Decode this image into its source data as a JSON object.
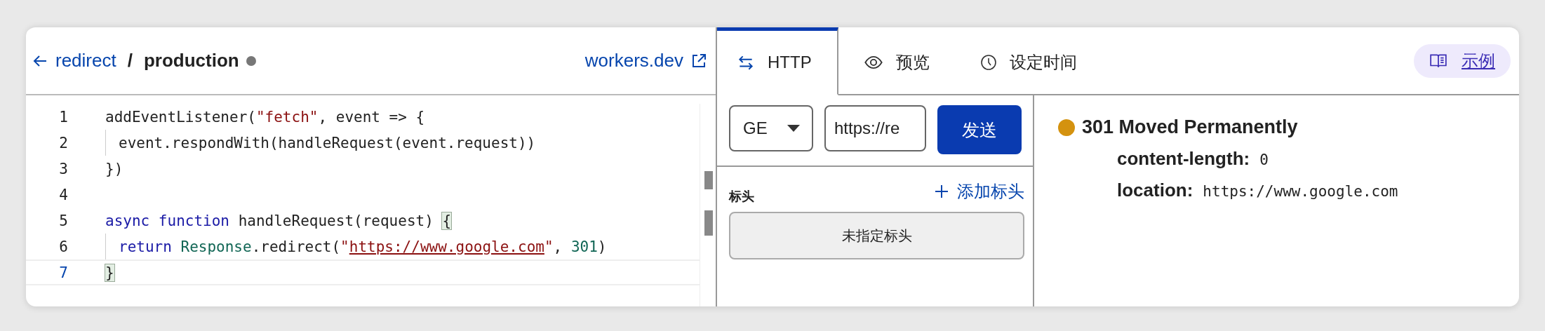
{
  "header": {
    "back_label": "redirect",
    "separator": "/",
    "environment": "production",
    "link": "workers.dev"
  },
  "editor": {
    "lines": [
      {
        "number": "1",
        "active": false,
        "indented": false,
        "tokens": [
          {
            "text": "addEventListener(",
            "kind": "plain"
          },
          {
            "text": "\"fetch\"",
            "kind": "string"
          },
          {
            "text": ", event => {",
            "kind": "plain"
          }
        ]
      },
      {
        "number": "2",
        "active": false,
        "indented": true,
        "tokens": [
          {
            "text": "event.respondWith(handleRequest(event.request))",
            "kind": "plain"
          }
        ]
      },
      {
        "number": "3",
        "active": false,
        "indented": false,
        "tokens": [
          {
            "text": "})",
            "kind": "plain"
          }
        ]
      },
      {
        "number": "4",
        "active": false
      },
      {
        "number": "5",
        "active": false,
        "indented": false,
        "tokens": [
          {
            "text": "async function",
            "kind": "keyword"
          },
          {
            "text": " handleRequest(request) ",
            "kind": "plain"
          },
          {
            "text": "{",
            "kind": "bracket"
          }
        ]
      },
      {
        "number": "6",
        "active": false,
        "indented": true,
        "tokens": [
          {
            "text": "return ",
            "kind": "keyword"
          },
          {
            "text": "Response",
            "kind": "type"
          },
          {
            "text": ".redirect(",
            "kind": "plain"
          },
          {
            "text": "\"",
            "kind": "string"
          },
          {
            "text": "https://www.google.com",
            "kind": "link"
          },
          {
            "text": "\"",
            "kind": "string"
          },
          {
            "text": ", ",
            "kind": "plain"
          },
          {
            "text": "301",
            "kind": "number"
          },
          {
            "text": ")",
            "kind": "plain"
          }
        ]
      },
      {
        "number": "7",
        "active": true,
        "indented": false,
        "tokens": [
          {
            "text": "}",
            "kind": "bracket"
          }
        ]
      }
    ]
  },
  "tabs": [
    {
      "label": "HTTP",
      "selected": true
    },
    {
      "label": "预览",
      "selected": false
    },
    {
      "label": "设定时间",
      "selected": false
    }
  ],
  "examples_button": "示例",
  "request": {
    "method": "GE",
    "url": "https://re",
    "send": "发送",
    "headers_title": "标头",
    "add_header": "添加标头",
    "no_headers": "未指定标头"
  },
  "response": {
    "status": "301 Moved Permanently",
    "headers": [
      {
        "name": "content-length:",
        "value": "0"
      },
      {
        "name": "location:",
        "value": "https://www.google.com"
      }
    ]
  }
}
